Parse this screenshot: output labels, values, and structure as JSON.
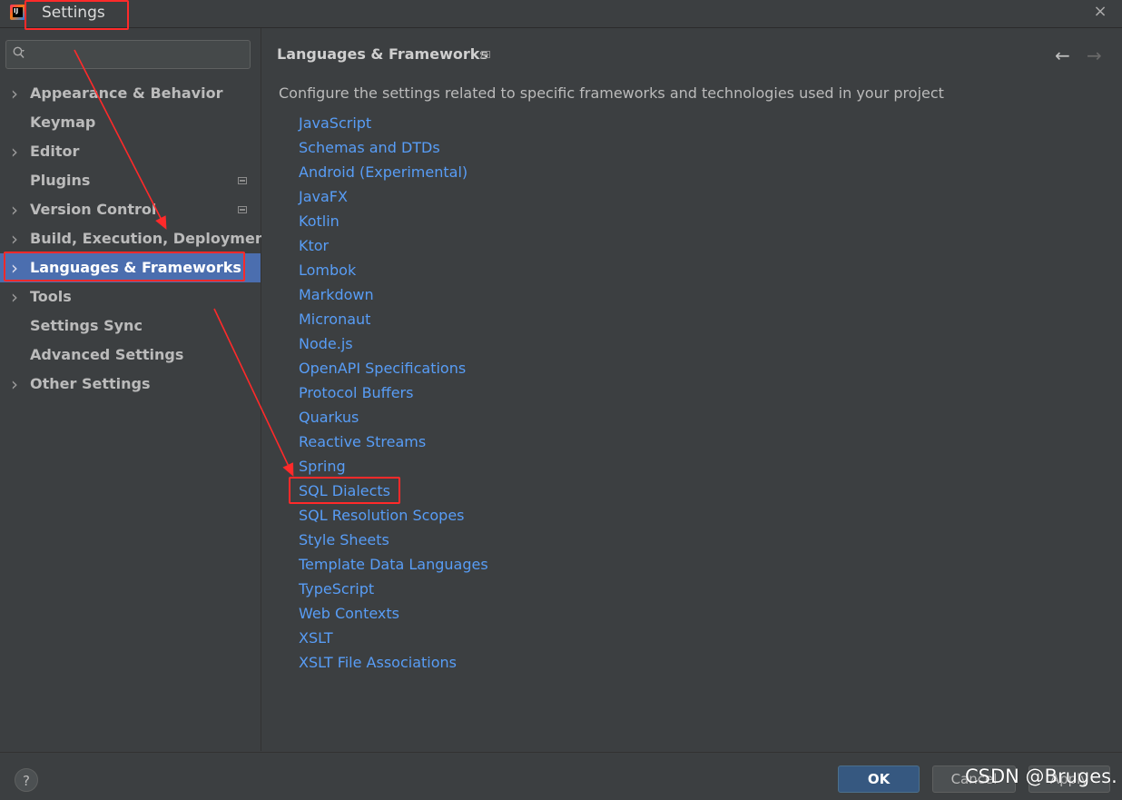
{
  "window": {
    "title": "Settings",
    "app_icon_text": "IJ",
    "close_glyph": "×"
  },
  "sidebar": {
    "search": {
      "placeholder": "",
      "value": ""
    },
    "items": [
      {
        "label": "Appearance & Behavior",
        "expandable": true,
        "project_icon": false
      },
      {
        "label": "Keymap",
        "expandable": false,
        "project_icon": false
      },
      {
        "label": "Editor",
        "expandable": true,
        "project_icon": false
      },
      {
        "label": "Plugins",
        "expandable": false,
        "project_icon": true
      },
      {
        "label": "Version Control",
        "expandable": true,
        "project_icon": true
      },
      {
        "label": "Build, Execution, Deployment",
        "expandable": true,
        "project_icon": false
      },
      {
        "label": "Languages & Frameworks",
        "expandable": true,
        "project_icon": false,
        "selected": true
      },
      {
        "label": "Tools",
        "expandable": true,
        "project_icon": false
      },
      {
        "label": "Settings Sync",
        "expandable": false,
        "project_icon": false
      },
      {
        "label": "Advanced Settings",
        "expandable": false,
        "project_icon": false
      },
      {
        "label": "Other Settings",
        "expandable": true,
        "project_icon": false
      }
    ]
  },
  "content": {
    "breadcrumb": "Languages & Frameworks",
    "back_glyph": "←",
    "forward_glyph": "→",
    "description": "Configure the settings related to specific frameworks and technologies used in your project",
    "links": [
      "JavaScript",
      "Schemas and DTDs",
      "Android (Experimental)",
      "JavaFX",
      "Kotlin",
      "Ktor",
      "Lombok",
      "Markdown",
      "Micronaut",
      "Node.js",
      "OpenAPI Specifications",
      "Protocol Buffers",
      "Quarkus",
      "Reactive Streams",
      "Spring",
      "SQL Dialects",
      "SQL Resolution Scopes",
      "Style Sheets",
      "Template Data Languages",
      "TypeScript",
      "Web Contexts",
      "XSLT",
      "XSLT File Associations"
    ]
  },
  "footer": {
    "help_label": "?",
    "ok_label": "OK",
    "cancel_label": "Cancel",
    "apply_label": "Apply"
  },
  "watermark": "CSDN @Bruges.",
  "colors": {
    "background": "#3c3f41",
    "selection": "#4b6eaf",
    "link": "#589df6",
    "annotation_red": "#ff2a2a",
    "ok_button": "#365880"
  }
}
